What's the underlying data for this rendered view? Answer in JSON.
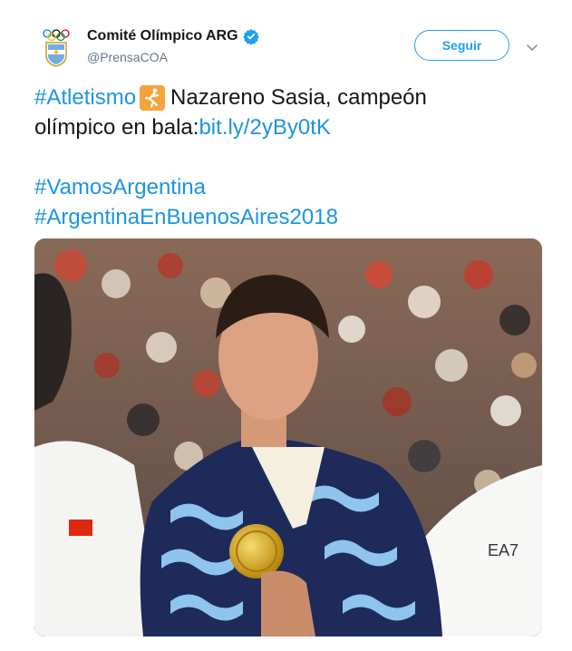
{
  "author": {
    "name": "Comité Olímpico ARG",
    "handle": "@PrensaCOA",
    "avatar_icon": "coa-logo-icon",
    "verified_icon": "verified-badge-icon"
  },
  "follow_button": {
    "label": "Seguir"
  },
  "menu_icon": "chevron-down-icon",
  "tweet": {
    "hashtag_atletismo": "#Atletismo",
    "emoji_icon": "athletics-shot-put-emoji",
    "text_part1": " Nazareno Sasia, campeón",
    "text_part2": "olímpico en bala: ",
    "link": "bit.ly/2yBy0tK",
    "hashtag_vamos": "#VamosArgentina",
    "hashtag_buenosaires": "#ArgentinaEnBuenosAires2018"
  },
  "photo": {
    "subject": "athlete-with-gold-medal",
    "alt": ""
  },
  "colors": {
    "link_blue": "#1b95e0",
    "follow_blue": "#1da1f2",
    "text": "#14171a",
    "muted": "#657786",
    "emoji_orange": "#f6a33b"
  }
}
